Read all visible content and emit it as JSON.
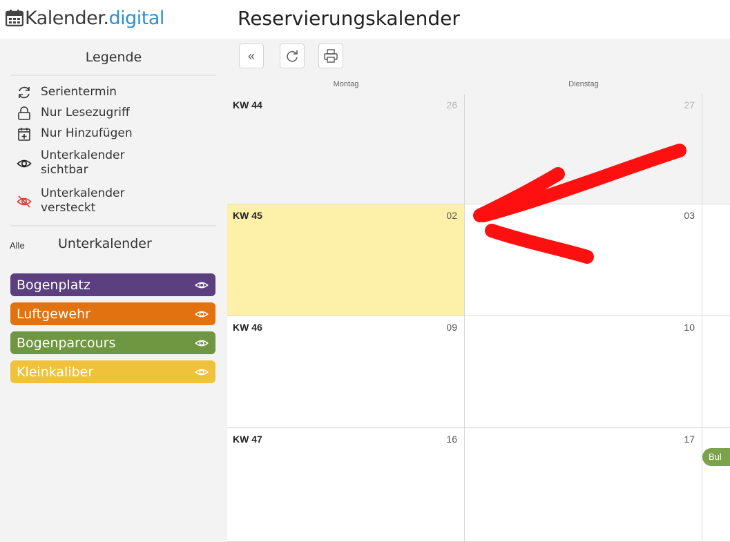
{
  "header": {
    "logo_main": "Kalender.",
    "logo_accent": "digital",
    "title": "Reservierungskalender"
  },
  "sidebar": {
    "legend_title": "Legende",
    "legend": [
      {
        "icon": "refresh-icon",
        "label": "Serientermin"
      },
      {
        "icon": "lock-icon",
        "label": "Nur Lesezugriff"
      },
      {
        "icon": "calendar-plus-icon",
        "label": "Nur Hinzufügen"
      },
      {
        "icon": "eye-icon",
        "label": "Unterkalender sichtbar"
      },
      {
        "icon": "eye-slash-icon",
        "label": "Unterkalender versteckt"
      }
    ],
    "all_label": "Alle",
    "subcalendars_title": "Unterkalender",
    "subcalendars": [
      {
        "label": "Bogenplatz",
        "color": "#5b3f7f"
      },
      {
        "label": "Luftgewehr",
        "color": "#e2720f"
      },
      {
        "label": "Bogenparcours",
        "color": "#6f9741"
      },
      {
        "label": "Kleinkaliber",
        "color": "#f0c13a"
      }
    ]
  },
  "toolbar": {
    "buttons": [
      "double-chevron-left-icon",
      "refresh-icon",
      "print-icon"
    ],
    "back_glyph": "«"
  },
  "calendar": {
    "days": [
      "Montag",
      "Dienstag"
    ],
    "weeks": [
      {
        "kw": "KW 44",
        "dates": [
          "26",
          "27"
        ]
      },
      {
        "kw": "KW 45",
        "dates": [
          "02",
          "03"
        ]
      },
      {
        "kw": "KW 46",
        "dates": [
          "09",
          "10"
        ]
      },
      {
        "kw": "KW 47",
        "dates": [
          "16",
          "17"
        ]
      }
    ],
    "event": "Bul",
    "today_color": "#fdf0a8",
    "past_color": "#f3f3f3",
    "annotation_color": "#ff0000"
  }
}
